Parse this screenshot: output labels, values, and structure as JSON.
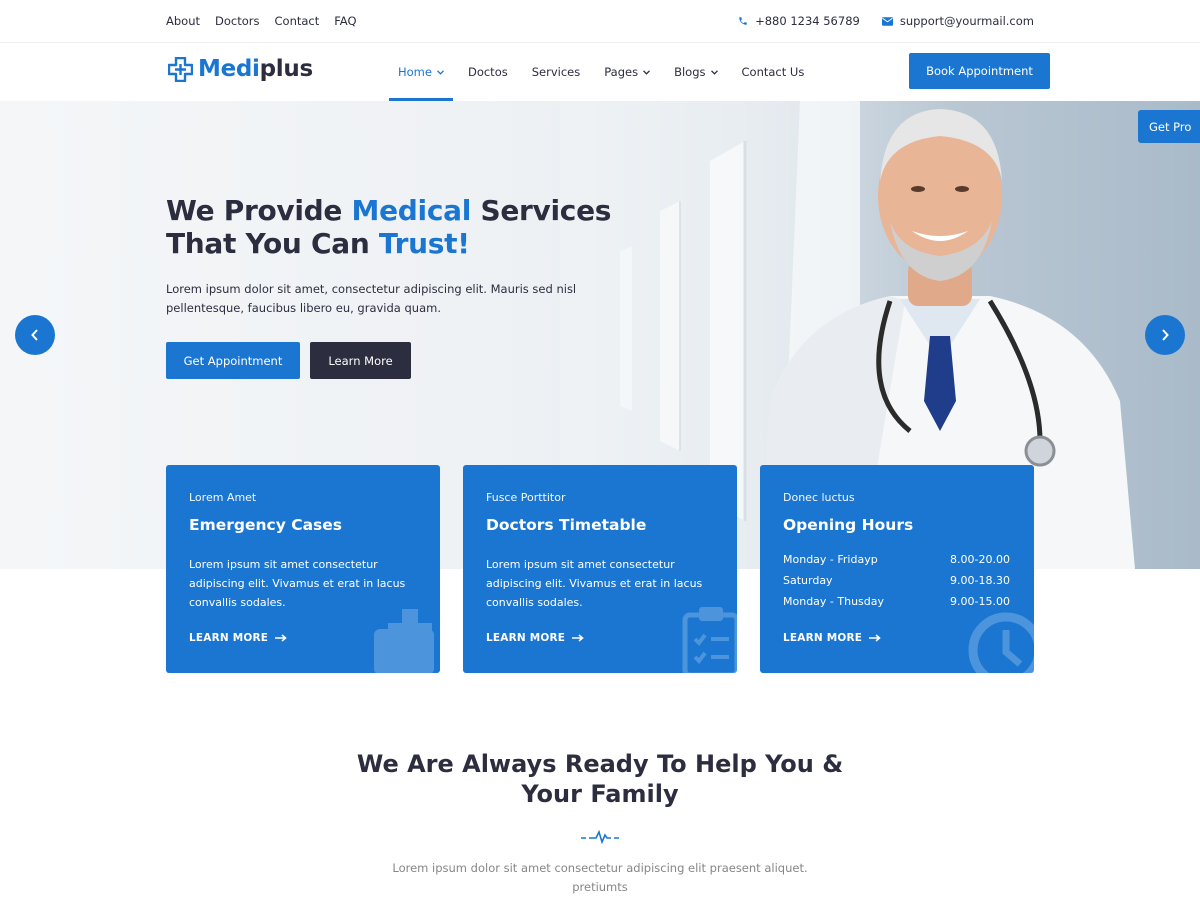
{
  "topbar": {
    "links": [
      "About",
      "Doctors",
      "Contact",
      "FAQ"
    ],
    "phone": "+880 1234 56789",
    "email": "support@yourmail.com"
  },
  "header": {
    "logo_part1": "Medi",
    "logo_part2": "plus",
    "nav": [
      {
        "label": "Home",
        "dropdown": true,
        "active": true
      },
      {
        "label": "Doctos",
        "dropdown": false
      },
      {
        "label": "Services",
        "dropdown": false
      },
      {
        "label": "Pages",
        "dropdown": true
      },
      {
        "label": "Blogs",
        "dropdown": true
      },
      {
        "label": "Contact Us",
        "dropdown": false
      }
    ],
    "book_label": "Book Appointment"
  },
  "hero": {
    "title_line1_a": "We Provide ",
    "title_line1_b": "Medical",
    "title_line1_c": " Services",
    "title_line2_a": "That You Can ",
    "title_line2_b": "Trust!",
    "text": "Lorem ipsum dolor sit amet, consectetur adipiscing elit. Mauris sed nisl pellentesque, faucibus libero eu, gravida quam.",
    "primary_label": "Get Appointment",
    "secondary_label": "Learn More",
    "get_pro_label": "Get Pro"
  },
  "cards": [
    {
      "small": "Lorem Amet",
      "title": "Emergency Cases",
      "text": "Lorem ipsum sit amet consectetur adipiscing elit. Vivamus et erat in lacus convallis sodales.",
      "link": "LEARN MORE"
    },
    {
      "small": "Fusce Porttitor",
      "title": "Doctors Timetable",
      "text": "Lorem ipsum sit amet consectetur adipiscing elit. Vivamus et erat in lacus convallis sodales.",
      "link": "LEARN MORE"
    },
    {
      "small": "Donec luctus",
      "title": "Opening Hours",
      "link": "LEARN MORE",
      "hours": [
        {
          "day": "Monday - Fridayp",
          "time": "8.00-20.00"
        },
        {
          "day": "Saturday",
          "time": "9.00-18.30"
        },
        {
          "day": "Monday - Thusday",
          "time": "9.00-15.00"
        }
      ]
    }
  ],
  "section": {
    "title_line1": "We Are Always Ready To Help You &",
    "title_line2": "Your Family",
    "text": "Lorem ipsum dolor sit amet consectetur adipiscing elit praesent aliquet. pretiumts"
  },
  "colors": {
    "accent": "#1a76d1",
    "dark": "#2c2d3f",
    "muted": "#868686"
  }
}
